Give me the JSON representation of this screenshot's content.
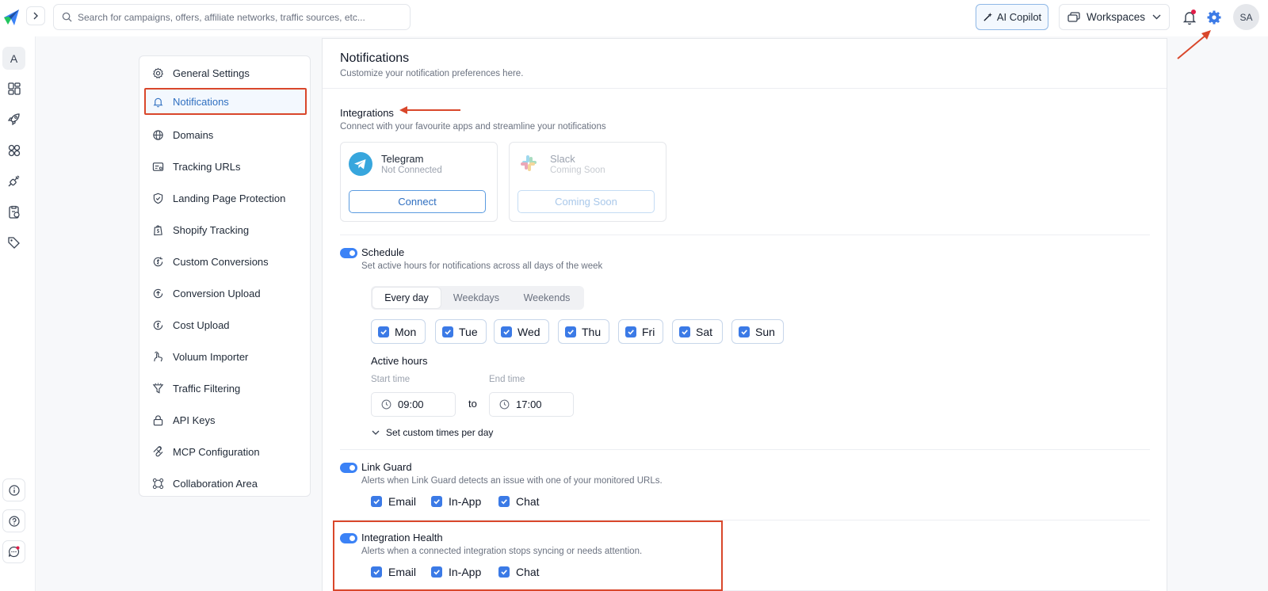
{
  "topbar": {
    "search_placeholder": "Search for campaigns, offers, affiliate networks, traffic sources, etc...",
    "ai_copilot": "AI Copilot",
    "workspaces": "Workspaces",
    "avatar": "SA"
  },
  "rail": {
    "active_letter": "A"
  },
  "settings_nav": {
    "items": [
      {
        "label": "General Settings",
        "icon": "gear-icon"
      },
      {
        "label": "Notifications",
        "icon": "bell-icon"
      },
      {
        "label": "Domains",
        "icon": "globe-icon"
      },
      {
        "label": "Tracking URLs",
        "icon": "link-card-icon"
      },
      {
        "label": "Landing Page Protection",
        "icon": "shield-icon"
      },
      {
        "label": "Shopify Tracking",
        "icon": "shopify-icon"
      },
      {
        "label": "Custom Conversions",
        "icon": "dollar-cycle-icon"
      },
      {
        "label": "Conversion Upload",
        "icon": "upload-cycle-icon"
      },
      {
        "label": "Cost Upload",
        "icon": "dollar-upload-icon"
      },
      {
        "label": "Voluum Importer",
        "icon": "importer-icon"
      },
      {
        "label": "Traffic Filtering",
        "icon": "filter-icon"
      },
      {
        "label": "API Keys",
        "icon": "lock-icon"
      },
      {
        "label": "MCP Configuration",
        "icon": "mcp-icon"
      },
      {
        "label": "Collaboration Area",
        "icon": "collaboration-icon"
      }
    ],
    "active_index": 1
  },
  "page": {
    "title": "Notifications",
    "subtitle": "Customize your notification preferences here."
  },
  "integrations": {
    "title": "Integrations",
    "subtitle": "Connect with your favourite apps and streamline your notifications",
    "cards": [
      {
        "name": "Telegram",
        "status": "Not Connected",
        "button": "Connect"
      },
      {
        "name": "Slack",
        "status": "Coming Soon",
        "button": "Coming Soon"
      }
    ]
  },
  "schedule": {
    "title": "Schedule",
    "subtitle": "Set active hours for notifications across all days of the week",
    "enabled": true,
    "tabs": [
      "Every day",
      "Weekdays",
      "Weekends"
    ],
    "active_tab": "Every day",
    "days": [
      "Mon",
      "Tue",
      "Wed",
      "Thu",
      "Fri",
      "Sat",
      "Sun"
    ],
    "active_hours_label": "Active hours",
    "start_label": "Start time",
    "start_value": "09:00",
    "to_label": "to",
    "end_label": "End time",
    "end_value": "17:00",
    "custom_times": "Set custom times per day"
  },
  "link_guard": {
    "title": "Link Guard",
    "subtitle": "Alerts when Link Guard detects an issue with one of your monitored URLs.",
    "enabled": true,
    "channels": [
      "Email",
      "In-App",
      "Chat"
    ]
  },
  "integration_health": {
    "title": "Integration Health",
    "subtitle": "Alerts when a connected integration stops syncing or needs attention.",
    "enabled": true,
    "channels": [
      "Email",
      "In-App",
      "Chat"
    ]
  },
  "colors": {
    "accent": "#3b82f6",
    "annotation": "#d9472b"
  }
}
